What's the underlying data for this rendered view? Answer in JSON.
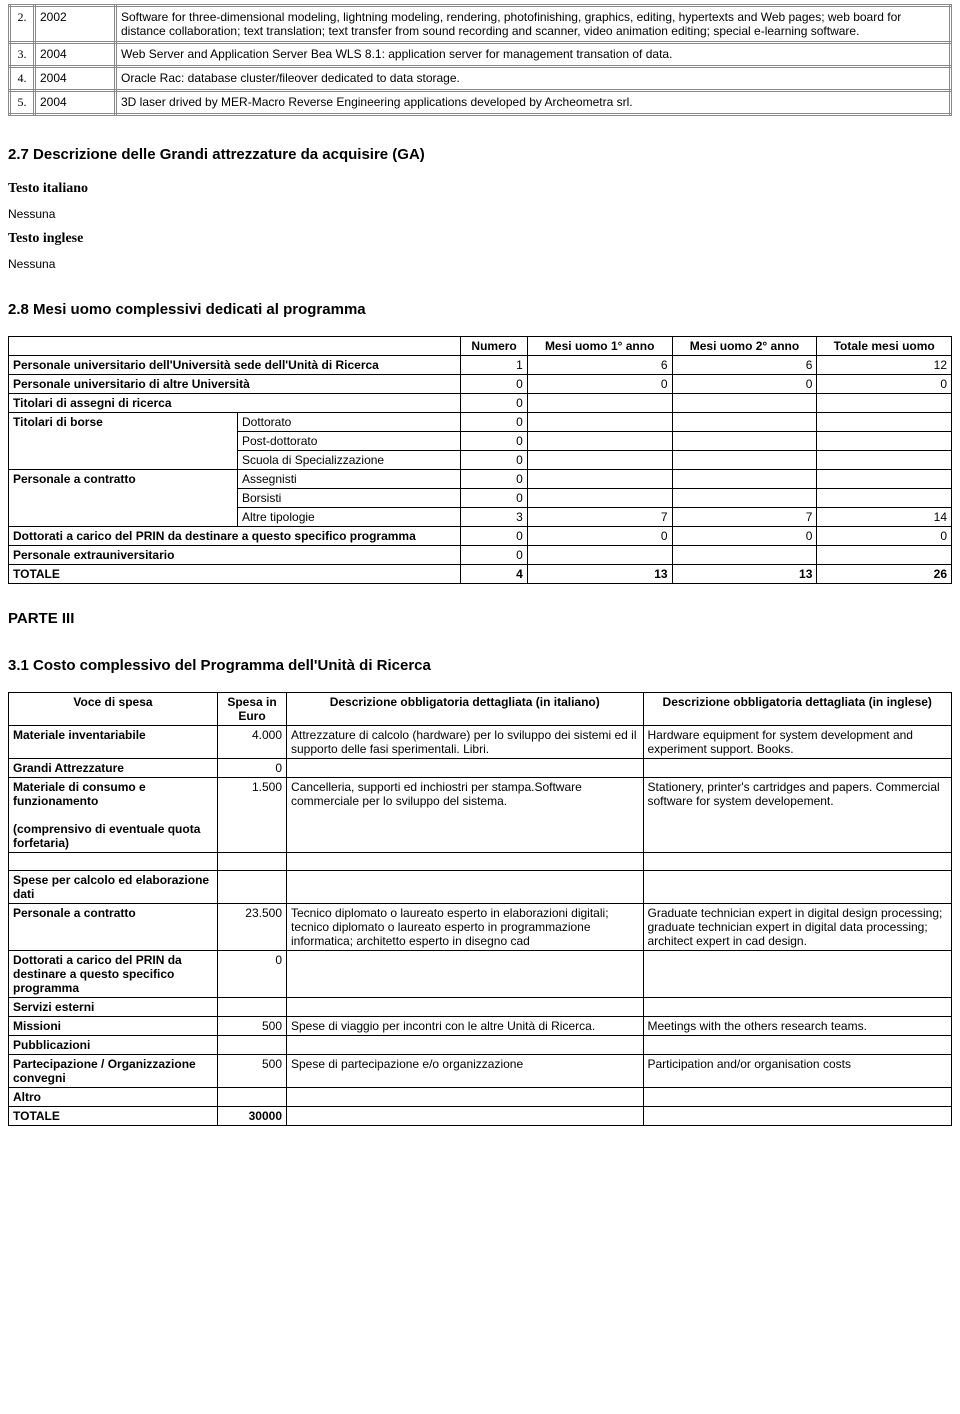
{
  "equip_table": {
    "rows": [
      {
        "n": "2.",
        "year": "2002",
        "desc": "Software for three-dimensional modeling, lightning modeling, rendering, photofinishing, graphics, editing, hypertexts and Web pages; web board for distance collaboration; text translation; text transfer from sound recording and scanner, video animation editing; special e-learning software."
      },
      {
        "n": "3.",
        "year": "2004",
        "desc": "Web Server and Application Server Bea WLS 8.1: application server for management transation of data."
      },
      {
        "n": "4.",
        "year": "2004",
        "desc": "Oracle Rac: database cluster/fileover dedicated to data storage."
      },
      {
        "n": "5.",
        "year": "2004",
        "desc": "3D laser drived by MER-Macro Reverse Engineering applications developed by Archeometra srl."
      }
    ]
  },
  "s27": {
    "title": "2.7 Descrizione delle Grandi attrezzature da acquisire (GA)",
    "lab_it": "Testo italiano",
    "val_it": "Nessuna",
    "lab_en": "Testo inglese",
    "val_en": "Nessuna"
  },
  "s28": {
    "title": "2.8 Mesi uomo complessivi dedicati al programma",
    "head": {
      "c1": "Numero",
      "c2": "Mesi uomo 1° anno",
      "c3": "Mesi uomo 2° anno",
      "c4": "Totale mesi uomo"
    },
    "rows": {
      "r1": {
        "label": "Personale universitario dell'Università sede dell'Unità di Ricerca",
        "n": "1",
        "a": "6",
        "b": "6",
        "t": "12"
      },
      "r2": {
        "label": "Personale universitario di altre Università",
        "n": "0",
        "a": "0",
        "b": "0",
        "t": "0"
      },
      "r3": {
        "label": "Titolari di assegni di ricerca",
        "n": "0",
        "a": "",
        "b": "",
        "t": ""
      },
      "r4": {
        "label": "Titolari di borse",
        "sub": "Dottorato",
        "n": "0"
      },
      "r5": {
        "sub": "Post-dottorato",
        "n": "0"
      },
      "r6": {
        "sub": "Scuola di Specializzazione",
        "n": "0"
      },
      "r7": {
        "label": "Personale a contratto",
        "sub": "Assegnisti",
        "n": "0"
      },
      "r8": {
        "sub": "Borsisti",
        "n": "0"
      },
      "r9": {
        "sub": "Altre tipologie",
        "n": "3",
        "a": "7",
        "b": "7",
        "t": "14"
      },
      "r10": {
        "label": "Dottorati a carico del PRIN da destinare a questo specifico programma",
        "n": "0",
        "a": "0",
        "b": "0",
        "t": "0"
      },
      "r11": {
        "label": "Personale extrauniversitario",
        "n": "0"
      },
      "r12": {
        "label": "TOTALE",
        "n": "4",
        "a": "13",
        "b": "13",
        "t": "26"
      }
    }
  },
  "parte3": "PARTE III",
  "s31": {
    "title": "3.1 Costo complessivo del Programma dell'Unità di Ricerca",
    "head": {
      "c1": "Voce di spesa",
      "c2": "Spesa in Euro",
      "c3": "Descrizione obbligatoria dettagliata (in italiano)",
      "c4": "Descrizione obbligatoria dettagliata (in inglese)"
    },
    "rows": {
      "r1": {
        "v": "Materiale inventariabile",
        "e": "4.000",
        "it": "Attrezzature di calcolo (hardware) per lo sviluppo dei sistemi ed il supporto delle fasi sperimentali. Libri.",
        "en": "Hardware equipment for system development and experiment support. Books."
      },
      "r2": {
        "v": "Grandi Attrezzature",
        "e": "0",
        "it": "",
        "en": ""
      },
      "r3": {
        "v": "Materiale di consumo e funzionamento",
        "v2": "(comprensivo di eventuale quota forfetaria)",
        "e": "1.500",
        "it": "Cancelleria, supporti ed inchiostri per stampa.Software commerciale per lo sviluppo del sistema.",
        "en": "Stationery, printer's cartridges and papers. Commercial software for system developement."
      },
      "r4": {
        "v": "Spese per calcolo ed elaborazione dati",
        "e": "",
        "it": "",
        "en": ""
      },
      "r5": {
        "v": "Personale a contratto",
        "e": "23.500",
        "it": "Tecnico diplomato o laureato esperto in elaborazioni digitali; tecnico diplomato o laureato esperto in programmazione informatica; architetto esperto in disegno cad",
        "en": "Graduate technician expert in digital design processing; graduate technician expert in digital data processing; architect expert in cad design."
      },
      "r6": {
        "v": "Dottorati a carico del PRIN da destinare a questo specifico programma",
        "e": "0",
        "it": "",
        "en": ""
      },
      "r7": {
        "v": "Servizi esterni",
        "e": "",
        "it": "",
        "en": ""
      },
      "r8": {
        "v": "Missioni",
        "e": "500",
        "it": "Spese di viaggio per incontri con le altre Unità di Ricerca.",
        "en": "Meetings with the others research teams."
      },
      "r9": {
        "v": "Pubblicazioni",
        "e": "",
        "it": "",
        "en": ""
      },
      "r10": {
        "v": "Partecipazione / Organizzazione convegni",
        "e": "500",
        "it": "Spese di partecipazione e/o organizzazione",
        "en": "Participation and/or organisation costs"
      },
      "r11": {
        "v": "Altro",
        "e": "",
        "it": "",
        "en": ""
      },
      "r12": {
        "v": "TOTALE",
        "e": "30000",
        "it": "",
        "en": ""
      }
    }
  }
}
